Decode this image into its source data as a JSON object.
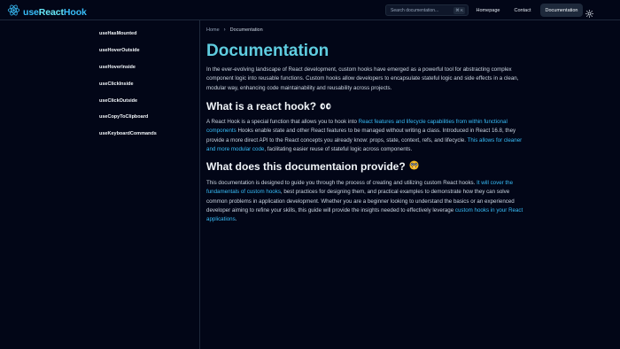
{
  "header": {
    "logo_prefix": "use",
    "logo_mid": "React",
    "logo_suffix": "Hook",
    "search_placeholder": "Search documentation...",
    "search_shortcut": "⌘ K",
    "nav": {
      "home": "Homepage",
      "contact": "Contact",
      "docs": "Documentation"
    }
  },
  "sidebar": {
    "items": [
      {
        "label": "useHasMounted"
      },
      {
        "label": "useHoverOutside"
      },
      {
        "label": "useHoverInside"
      },
      {
        "label": "useClickInside"
      },
      {
        "label": "useClickOutside"
      },
      {
        "label": "useCopyToClipboard"
      },
      {
        "label": "useKeyboardCommands"
      }
    ]
  },
  "breadcrumb": {
    "home": "Home",
    "current": "Documentation"
  },
  "main": {
    "title": "Documentation",
    "intro": "In the ever-evolving landscape of React development, custom hooks have emerged as a powerful tool for abstracting complex component logic into reusable functions. Custom hooks allow developers to encapsulate stateful logic and side effects in a clean, modular way, enhancing code maintainability and reusability across projects.",
    "section1": {
      "heading": "What is a react hook?",
      "p_1": "A React Hook is a special function that allows you to hook into ",
      "link_1": "React features and lifecycle capabilities from within functional components",
      "p_2": " Hooks enable state and other React features to be managed without writing a class. Introduced in React 16.8, they provide a more direct API to the React concepts you already know: props, state, context, refs, and lifecycle. ",
      "link_2": "This allows for cleaner and more modular code",
      "p_3": ", facilitating easier reuse of stateful logic across components."
    },
    "section2": {
      "heading": "What does this documentaion provide?",
      "p_1": "This documentation is designed to guide you through the process of creating and utilizing custom React hooks. ",
      "link_1": "It will cover the fundamentals of custom hooks",
      "p_2": ", best practices for designing them, and practical examples to demonstrate how they can solve common problems in application development. Whether you are a beginner looking to understand the basics or an experienced developer aiming to refine your skills, this guide will provide the insights needed to effectively leverage ",
      "link_2": "custom hooks in your React applications",
      "p_3": "."
    }
  },
  "colors": {
    "background": "#020617",
    "accent": "#38bdf8",
    "title": "#5fcde0",
    "text": "#cbd5e1"
  },
  "icons": [
    "react-logo-icon",
    "sun-icon",
    "chevron-right-icon",
    "eyes-emoji-icon",
    "nerd-face-emoji-icon"
  ]
}
